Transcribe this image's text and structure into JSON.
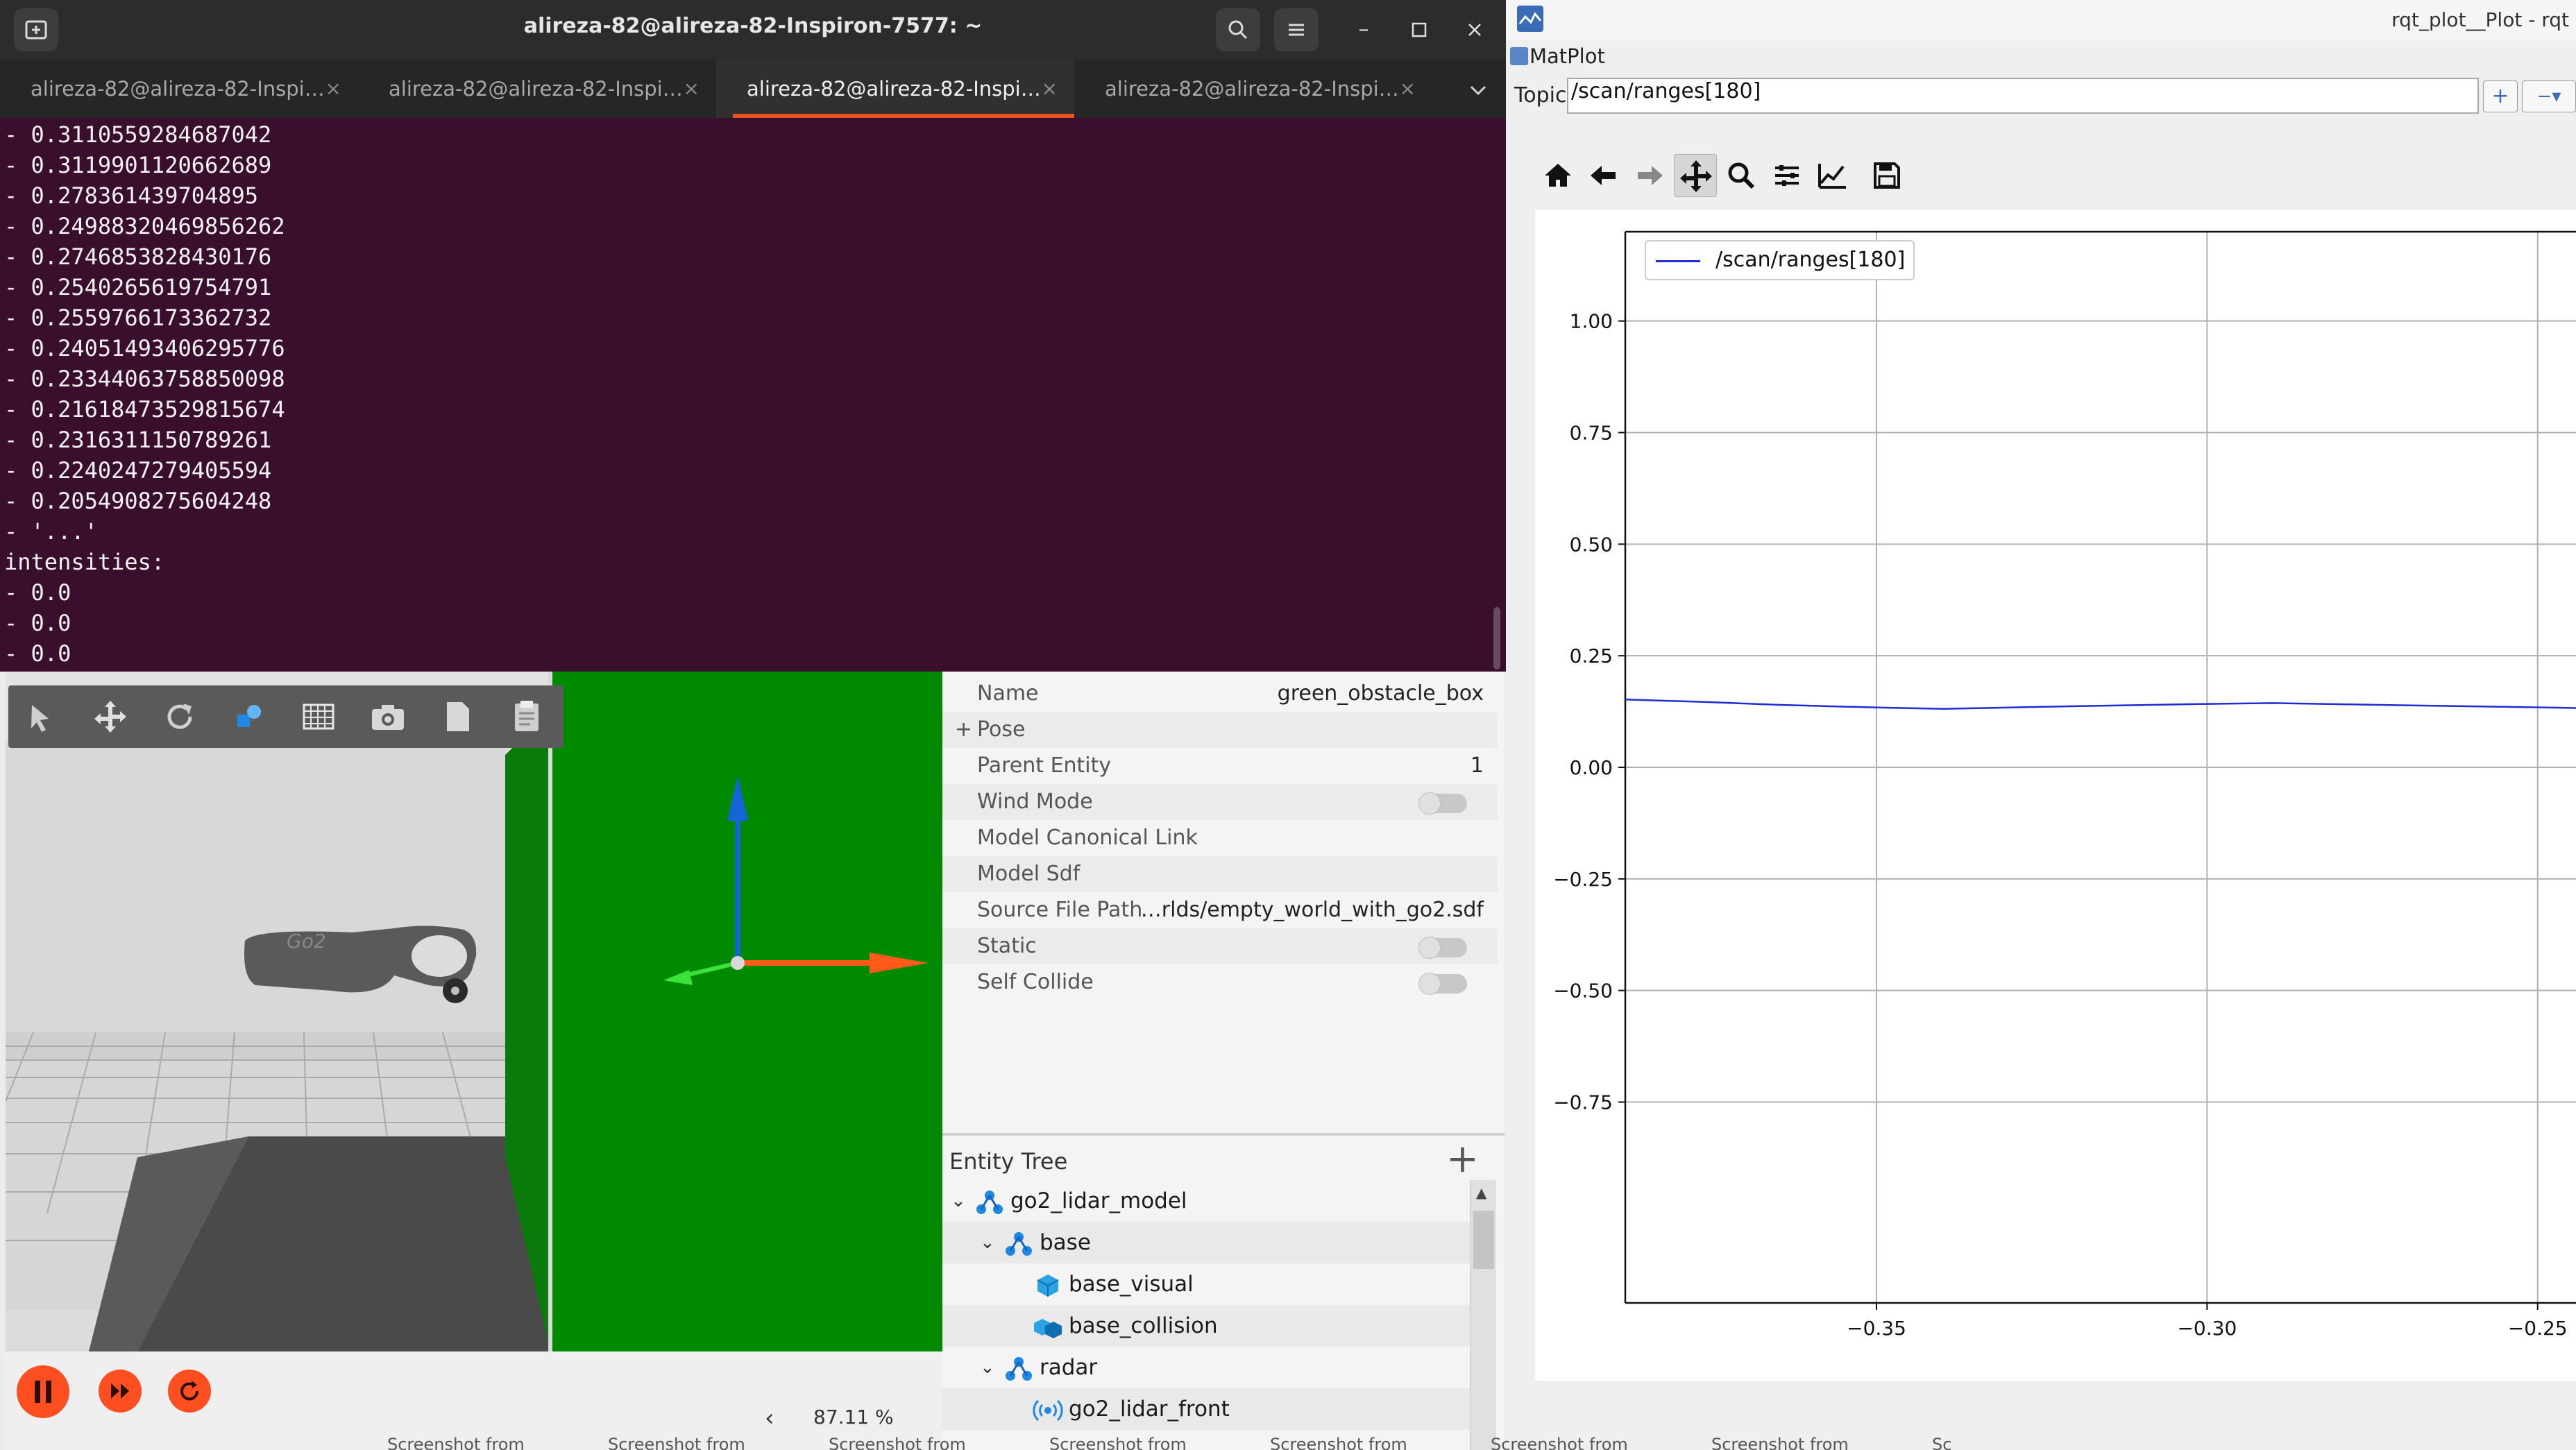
{
  "terminal": {
    "title": "alireza-82@alireza-82-Inspiron-7577: ~",
    "tabs": [
      {
        "label": "alireza-82@alireza-82-Inspi…",
        "active": false
      },
      {
        "label": "alireza-82@alireza-82-Inspi…",
        "active": false
      },
      {
        "label": "alireza-82@alireza-82-Inspi…",
        "active": true
      },
      {
        "label": "alireza-82@alireza-82-Inspi…",
        "active": false
      }
    ],
    "lines": [
      "- 0.3110559284687042",
      "- 0.3119901120662689",
      "- 0.278361439704895",
      "- 0.24988320469856262",
      "- 0.2746853828430176",
      "- 0.2540265619754791",
      "- 0.2559766173362732",
      "- 0.24051493406295776",
      "- 0.23344063758850098",
      "- 0.21618473529815674",
      "- 0.2316311150789261",
      "- 0.2240247279405594",
      "- 0.2054908275604248",
      "- '...'",
      "intensities:",
      "- 0.0",
      "- 0.0",
      "- 0.0"
    ],
    "colors": {
      "background": "#3a0f2e",
      "accent": "#e95420"
    }
  },
  "gazebo": {
    "toolbar_icons": [
      "select-icon",
      "translate-icon",
      "rotate-icon",
      "shapes-icon",
      "grid-icon",
      "camera-icon",
      "copy-icon",
      "paste-icon"
    ],
    "zoom": "87.11 %",
    "controls": [
      "pause-icon",
      "step-icon",
      "reset-icon"
    ],
    "properties": [
      {
        "label": "Name",
        "value": "green_obstacle_box",
        "toggle": false
      },
      {
        "label": "Pose",
        "value": "",
        "toggle": false,
        "expandable": true
      },
      {
        "label": "Parent Entity",
        "value": "1",
        "toggle": false
      },
      {
        "label": "Wind Mode",
        "value": "",
        "toggle": true
      },
      {
        "label": "Model Canonical Link",
        "value": "",
        "toggle": false
      },
      {
        "label": "Model Sdf",
        "value": "",
        "toggle": false
      },
      {
        "label": "Source File Path",
        "value": "…rlds/empty_world_with_go2.sdf",
        "toggle": false
      },
      {
        "label": "Static",
        "value": "",
        "toggle": true
      },
      {
        "label": "Self Collide",
        "value": "",
        "toggle": true
      }
    ],
    "entity_tree": {
      "title": "Entity Tree",
      "items": [
        {
          "label": "go2_lidar_model",
          "depth": 0,
          "expanded": true,
          "icon": "model-icon"
        },
        {
          "label": "base",
          "depth": 1,
          "expanded": true,
          "icon": "link-icon"
        },
        {
          "label": "base_visual",
          "depth": 2,
          "expanded": false,
          "icon": "visual-icon"
        },
        {
          "label": "base_collision",
          "depth": 2,
          "expanded": false,
          "icon": "collision-icon"
        },
        {
          "label": "radar",
          "depth": 1,
          "expanded": true,
          "icon": "link-icon"
        },
        {
          "label": "go2_lidar_front",
          "depth": 2,
          "expanded": false,
          "icon": "sensor-icon"
        }
      ]
    },
    "colors": {
      "obstacle": "#008a00",
      "control": "#ff4e1f"
    }
  },
  "rqt": {
    "window_title": "rqt_plot__Plot - rqt",
    "plugin_label": "MatPlot",
    "topic_label": "Topic",
    "topic_value": "/scan/ranges[180]",
    "add_label": "+",
    "remove_label": "−▾",
    "toolbar_icons": [
      "home-icon",
      "back-icon",
      "forward-icon",
      "pan-icon",
      "zoom-icon",
      "configure-icon",
      "edit-curves-icon",
      "save-icon"
    ]
  },
  "chart_data": {
    "type": "line",
    "title": "",
    "xlabel": "",
    "ylabel": "",
    "xlim": [
      -0.388,
      -0.24
    ],
    "ylim": [
      -1.2,
      1.2
    ],
    "x_ticks": [
      "−0.35",
      "−0.30",
      "−0.25"
    ],
    "x_tick_values": [
      -0.35,
      -0.3,
      -0.25
    ],
    "y_ticks": [
      "1.00",
      "0.75",
      "0.50",
      "0.25",
      "0.00",
      "−0.25",
      "−0.50",
      "−0.75"
    ],
    "y_tick_values": [
      1.0,
      0.75,
      0.5,
      0.25,
      0.0,
      -0.25,
      -0.5,
      -0.75
    ],
    "grid": true,
    "legend_position": "top-left",
    "series": [
      {
        "name": "/scan/ranges[180]",
        "color": "#1f2bd6",
        "x": [
          -0.388,
          -0.375,
          -0.365,
          -0.35,
          -0.34,
          -0.32,
          -0.3,
          -0.29,
          -0.27,
          -0.24
        ],
        "y": [
          0.152,
          0.146,
          0.14,
          0.134,
          0.131,
          0.137,
          0.142,
          0.144,
          0.139,
          0.132
        ]
      }
    ]
  },
  "taskbar": {
    "items": [
      "Screenshot from",
      "Screenshot from",
      "Screenshot from",
      "Screenshot from",
      "Screenshot from",
      "Screenshot from",
      "Screenshot from",
      "Sc"
    ]
  }
}
